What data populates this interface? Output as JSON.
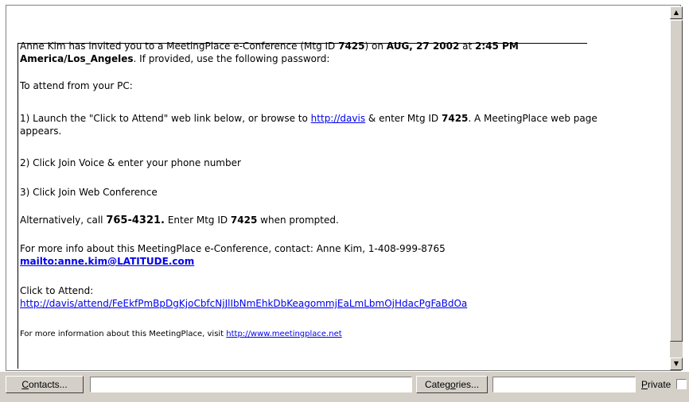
{
  "message": {
    "invite_prefix": "Anne Kim has invited you to a MeetingPlace e-Conference (Mtg ID ",
    "mtg_id": "7425",
    "invite_mid": ") on ",
    "date": "AUG, 27 2002",
    "at": " at ",
    "time": "2:45 PM",
    "timezone": "America/Los_Angeles",
    "password_text": ". If provided, use the following password:",
    "attend_pc": "To attend from your PC:",
    "step1_prefix": "1) Launch the \"Click to Attend\" web link below, or browse to ",
    "step1_link": "http://davis",
    "step1_mid": "  & enter Mtg ID ",
    "step1_suffix": ". A MeetingPlace web page",
    "step1_line2": "appears.",
    "step2": "2) Click Join Voice & enter your phone number",
    "step3": "3) Click Join Web Conference",
    "alt_prefix": "Alternatively, call  ",
    "alt_phone": "765-4321.",
    "alt_mid": "  Enter Mtg ID ",
    "alt_suffix": " when prompted.",
    "more_info": "For more info about this MeetingPlace e-Conference, contact: Anne Kim,  1-408-999-8765",
    "mailto": "mailto:anne.kim@LATITUDE.com",
    "click_to_attend": "Click to Attend:",
    "attend_link": "http://davis/attend/FeEkfPmBpDgKjoCbfcNjJlIbNmEhkDbKeagommjEaLmLbmOjHdacPgFaBdOa",
    "footer_prefix": "For more information about this MeetingPlace, visit ",
    "footer_link": "http://www.meetingplace.net"
  },
  "scrollbar": {
    "up_arrow": "▲",
    "down_arrow": "▼"
  },
  "bottom": {
    "contacts_label_u": "C",
    "contacts_label_rest": "ontacts...",
    "categories_label_pre": "Categ",
    "categories_label_u": "o",
    "categories_label_rest": "ries...",
    "private_label_u": "P",
    "private_label_rest": "rivate",
    "contacts_value": "",
    "categories_value": ""
  }
}
